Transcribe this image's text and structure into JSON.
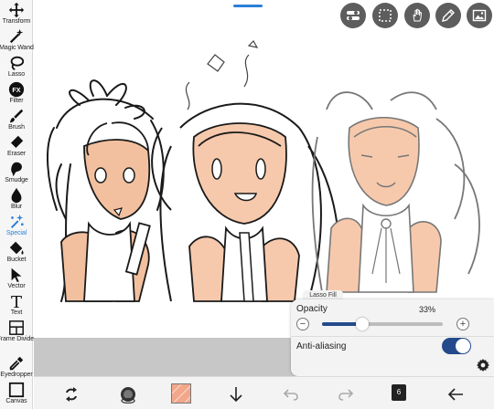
{
  "tools": [
    {
      "key": "transform",
      "label": "Transform",
      "icon": "transform-icon"
    },
    {
      "key": "magic-wand",
      "label": "Magic Wand",
      "icon": "magic-wand-icon"
    },
    {
      "key": "lasso",
      "label": "Lasso",
      "icon": "lasso-icon"
    },
    {
      "key": "filter",
      "label": "Filter",
      "icon": "filter-icon"
    },
    {
      "key": "brush",
      "label": "Brush",
      "icon": "brush-icon"
    },
    {
      "key": "eraser",
      "label": "Eraser",
      "icon": "eraser-icon"
    },
    {
      "key": "smudge",
      "label": "Smudge",
      "icon": "smudge-icon"
    },
    {
      "key": "blur",
      "label": "Blur",
      "icon": "blur-icon"
    },
    {
      "key": "special",
      "label": "Special",
      "icon": "special-icon"
    },
    {
      "key": "bucket",
      "label": "Bucket",
      "icon": "bucket-icon"
    },
    {
      "key": "vector",
      "label": "Vector",
      "icon": "vector-icon"
    },
    {
      "key": "text",
      "label": "Text",
      "icon": "text-icon"
    },
    {
      "key": "frame-divider",
      "label": "Frame Divider",
      "icon": "frame-divider-icon"
    },
    {
      "key": "eyedropper",
      "label": "Eyedropper",
      "icon": "eyedropper-icon"
    },
    {
      "key": "canvas",
      "label": "Canvas",
      "icon": "canvas-icon"
    }
  ],
  "active_tool": "Special",
  "filter_icon_text": "FX",
  "text_icon_text": "T",
  "top_buttons": [
    {
      "key": "quick-menu",
      "icon": "toggle-icon"
    },
    {
      "key": "selection",
      "icon": "dashed-square-icon"
    },
    {
      "key": "gesture",
      "icon": "hand-icon"
    },
    {
      "key": "pen",
      "icon": "pencil-icon"
    },
    {
      "key": "reference",
      "icon": "image-icon"
    }
  ],
  "lasso_panel": {
    "tab_label": "Lasso Fill",
    "opacity_label": "Opacity",
    "opacity_value": "33%",
    "opacity_fraction": 0.33,
    "minus_label": "−",
    "plus_label": "+",
    "anti_aliasing_label": "Anti-aliasing",
    "anti_aliasing_on": true
  },
  "bottom_bar": {
    "layer_count": "6",
    "current_color": "#f2a68a"
  },
  "colors": {
    "accent": "#2b7fd7",
    "slider": "#244a8b",
    "skin": "#f7c9ac",
    "button_bg": "#5d5d5d"
  }
}
